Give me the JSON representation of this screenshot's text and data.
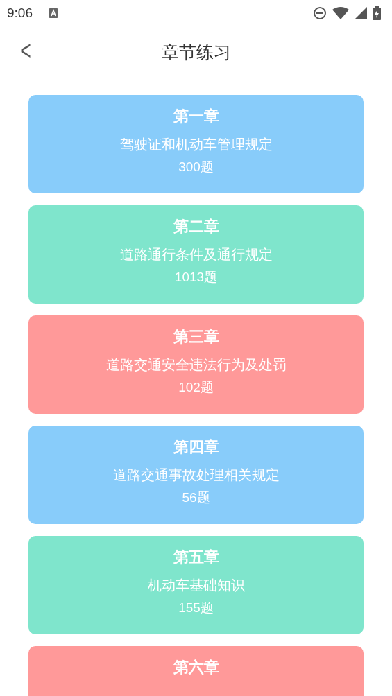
{
  "status_bar": {
    "time": "9:06"
  },
  "header": {
    "back": "<",
    "title": "章节练习"
  },
  "chapters": [
    {
      "title": "第一章",
      "subtitle": "驾驶证和机动车管理规定",
      "count": "300题",
      "color": "#88ccfa"
    },
    {
      "title": "第二章",
      "subtitle": "道路通行条件及通行规定",
      "count": "1013题",
      "color": "#7fe5cc"
    },
    {
      "title": "第三章",
      "subtitle": "道路交通安全违法行为及处罚",
      "count": "102题",
      "color": "#ff9999"
    },
    {
      "title": "第四章",
      "subtitle": "道路交通事故处理相关规定",
      "count": "56题",
      "color": "#88ccfa"
    },
    {
      "title": "第五章",
      "subtitle": "机动车基础知识",
      "count": "155题",
      "color": "#7fe5cc"
    },
    {
      "title": "第六章",
      "color": "#ff9999"
    }
  ]
}
